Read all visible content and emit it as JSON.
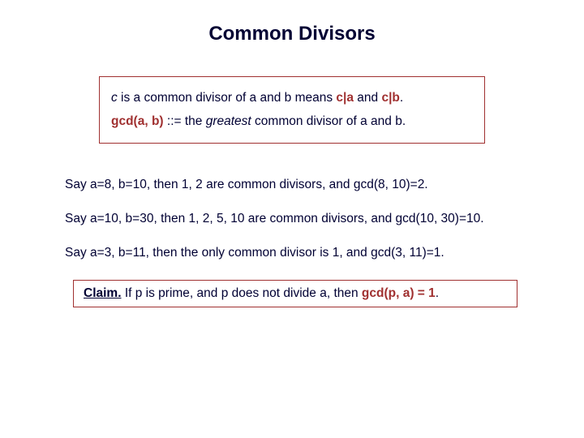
{
  "title": "Common Divisors",
  "definition": {
    "line1_pre": "c",
    "line1_mid": " is a common divisor of a and b means ",
    "line1_a": "c|a",
    "line1_and": " and ",
    "line1_b": "c|b",
    "line1_end": ".",
    "line2_pre": "gcd(a, b) ",
    "line2_sym": "::= the ",
    "line2_greatest": "greatest",
    "line2_post": " common divisor of a and b."
  },
  "examples": {
    "e1": "Say a=8, b=10, then 1, 2 are common divisors, and gcd(8, 10)=2.",
    "e2": "Say a=10, b=30, then 1, 2, 5, 10 are common divisors, and gcd(10, 30)=10.",
    "e3": "Say a=3, b=11, then the only common divisor is 1, and gcd(3, 11)=1."
  },
  "claim": {
    "label": "Claim.",
    "pre": "  If p is prime, and p does not divide a, then ",
    "accent": "gcd(p, a) = 1",
    "post": "."
  }
}
